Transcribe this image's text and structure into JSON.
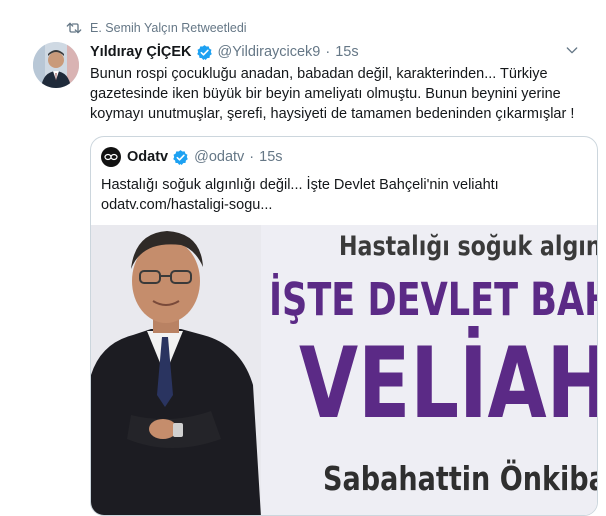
{
  "retweet": {
    "label": "E. Semih Yalçın Retweetledi"
  },
  "tweet": {
    "display_name": "Yıldıray ÇİÇEK",
    "handle": "@Yildiraycicek9",
    "separator": "·",
    "time": "15s",
    "text": "Bunun rospi çocukluğu anadan, babadan değil, karakterinden... Türkiye gazetesinde iken büyük bir beyin ameliyatı olmuştu. Bunun beynini yerine koymayı unutmuşlar, şerefi, haysiyeti de tamamen bedeninden çıkarmışlar !"
  },
  "quote": {
    "display_name": "Odatv",
    "handle": "@odatv",
    "separator": "·",
    "time": "15s",
    "text_line1": "Hastalığı soğuk algınlığı değil... İşte Devlet Bahçeli'nin veliahtı",
    "text_line2": "odatv.com/hastaligi-sogu...",
    "image": {
      "headline1": "Hastalığı soğuk algınl",
      "headline2": "İŞTE DEVLET BAHÇ",
      "headline3": "VELİAH",
      "headline4": "Sabahattin Önkiba"
    }
  },
  "colors": {
    "verified": "#1da1f2",
    "secondary_text": "#657786",
    "headline_purple": "#5b2a86"
  },
  "icons": {
    "retweet": "retweet-icon",
    "verified": "verified-badge-icon",
    "more": "chevron-down-icon"
  }
}
